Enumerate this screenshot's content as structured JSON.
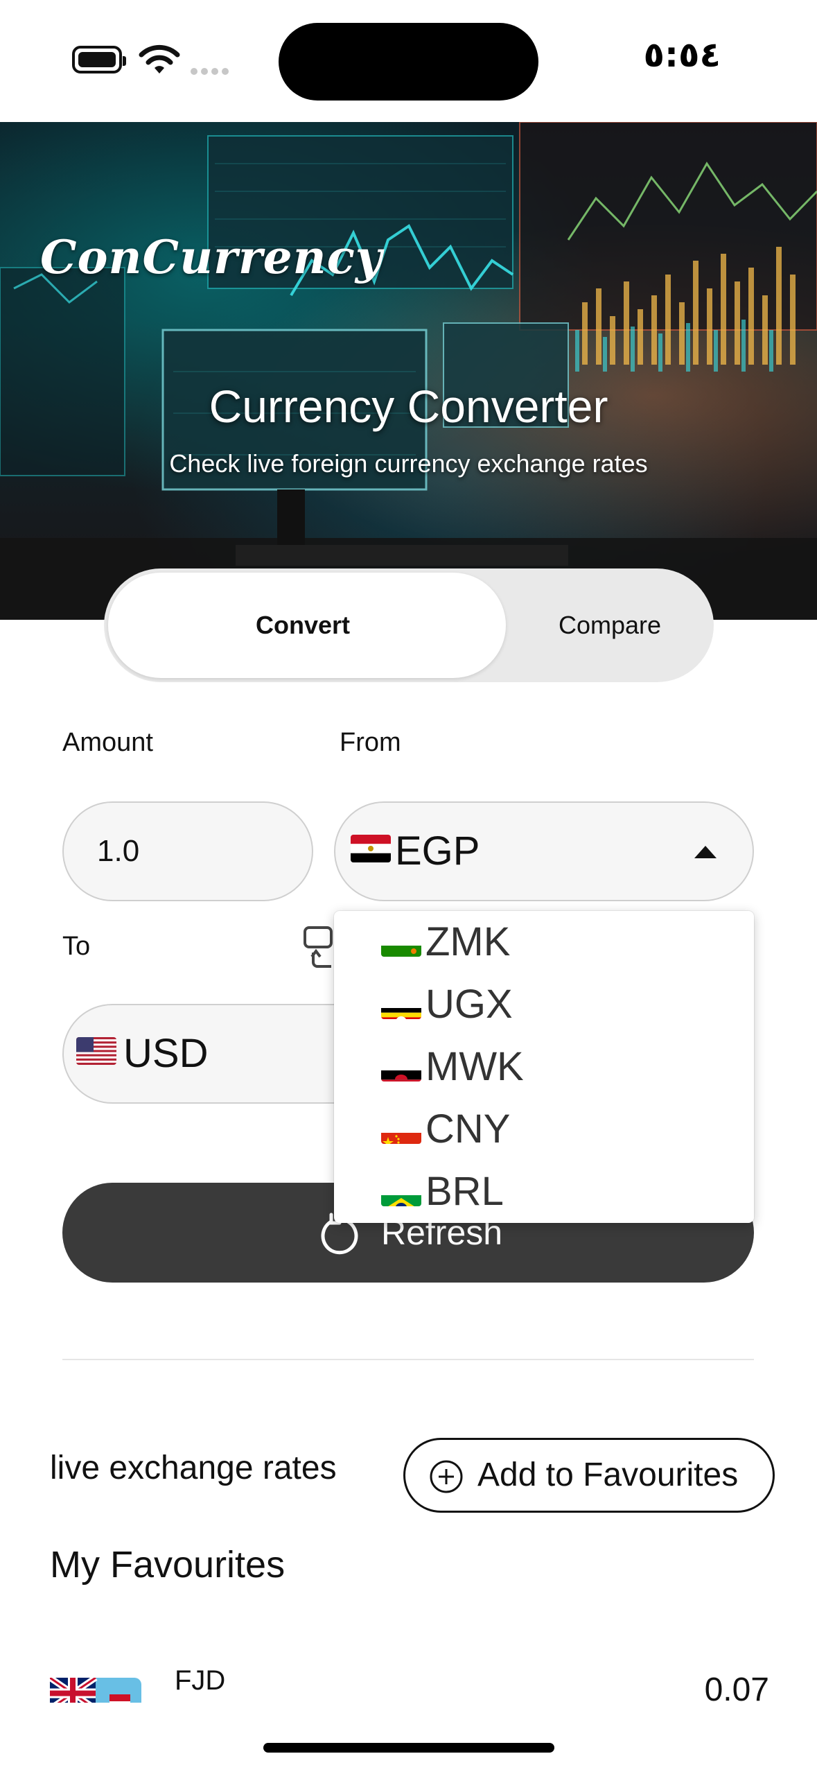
{
  "status_bar": {
    "time": "٥:٥٤"
  },
  "hero": {
    "brand": "ConCurrency",
    "title": "Currency Converter",
    "subtitle": "Check live foreign currency exchange rates"
  },
  "mode_toggle": {
    "options": [
      {
        "label": "Convert",
        "selected": true
      },
      {
        "label": "Compare",
        "selected": false
      }
    ]
  },
  "form": {
    "amount_label": "Amount",
    "amount_value": "1.0",
    "from_label": "From",
    "from_currency": {
      "code": "EGP",
      "flag": "egypt-flag"
    },
    "to_label": "To",
    "to_currency": {
      "code": "USD",
      "flag": "usa-flag"
    },
    "refresh_label": "Refresh"
  },
  "from_dropdown": {
    "open": true,
    "options": [
      {
        "code": "ZMK",
        "flag": "zambia-flag"
      },
      {
        "code": "UGX",
        "flag": "uganda-flag"
      },
      {
        "code": "MWK",
        "flag": "malawi-flag"
      },
      {
        "code": "CNY",
        "flag": "china-flag"
      },
      {
        "code": "BRL",
        "flag": "brazil-flag"
      }
    ]
  },
  "rates_section": {
    "title": "live exchange rates",
    "add_button_label": "Add to Favourites",
    "favourites_heading": "My Favourites",
    "favourites": [
      {
        "code": "FJD",
        "rate": "0.07",
        "flag": "fiji-flag"
      }
    ]
  },
  "colors": {
    "refresh_button": "#3a3a3a",
    "toggle_track": "#e9e9e9",
    "field_bg": "#f6f6f6"
  }
}
